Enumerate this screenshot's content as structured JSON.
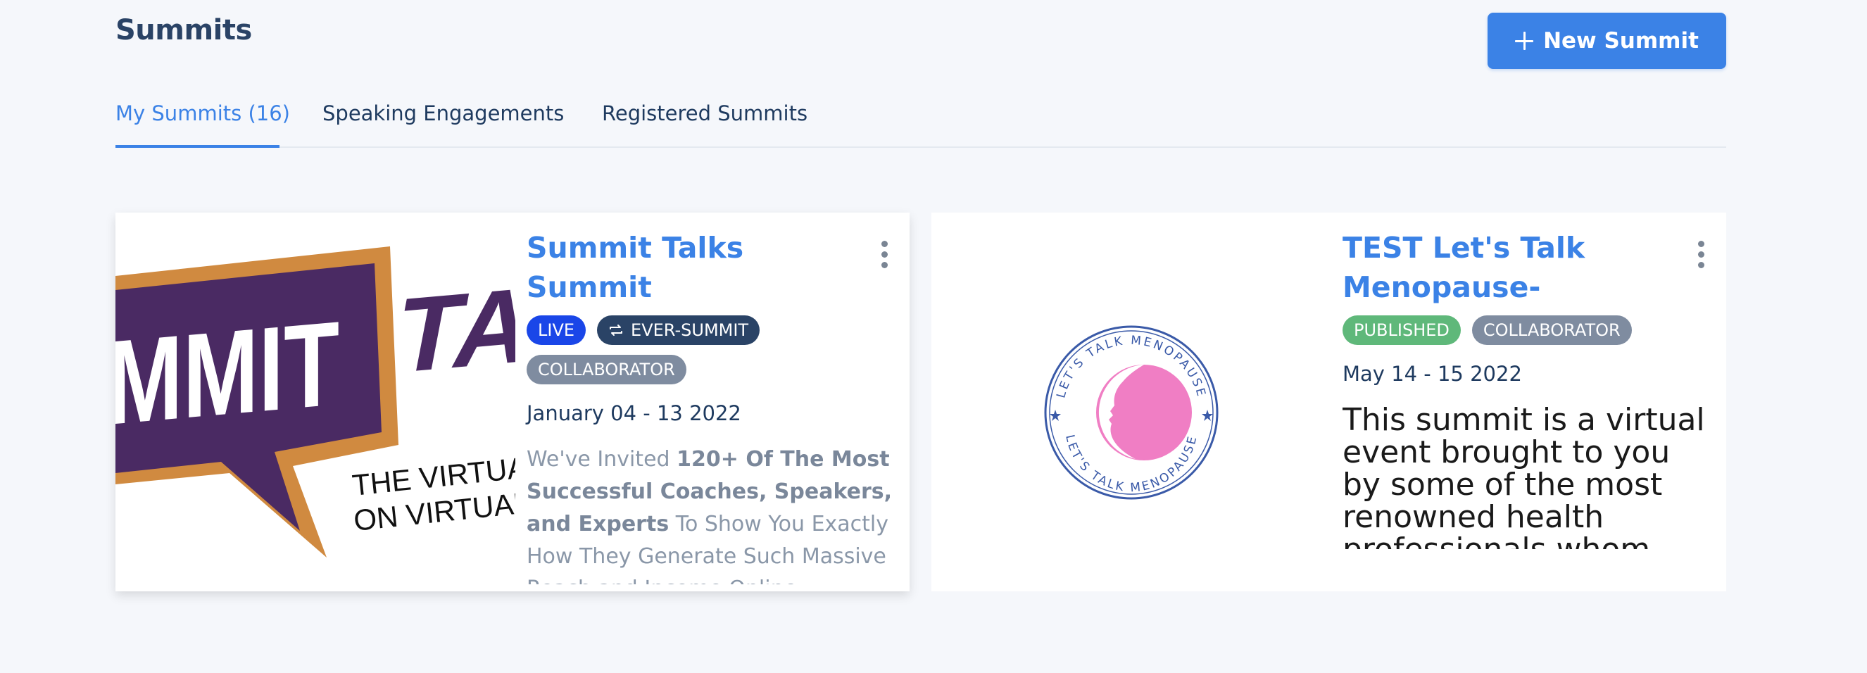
{
  "header": {
    "title": "Summits",
    "new_button_label": "New Summit"
  },
  "tabs": [
    {
      "label": "My Summits (16)",
      "active": true
    },
    {
      "label": "Speaking Engagements",
      "active": false
    },
    {
      "label": "Registered Summits",
      "active": false
    }
  ],
  "cards": [
    {
      "title": "Summit Talks Summit",
      "badges": [
        "LIVE",
        "EVER-SUMMIT",
        "COLLABORATOR"
      ],
      "date": "January 04 - 13 2022",
      "description_parts": [
        {
          "text": "We've Invited ",
          "bold": false
        },
        {
          "text": "120+ Of The Most Successful Coaches, Speakers, and Experts",
          "bold": true
        },
        {
          "text": " To Show You Exactly How They Generate Such Massive Reach and Income Online",
          "bold": false
        }
      ],
      "image": {
        "logo_text": "MMIT",
        "logo_text_2": "TA",
        "tagline_line1": "THE VIRTUA",
        "tagline_line2": "ON VIRTUAL"
      }
    },
    {
      "title": "TEST Let's Talk Menopause-",
      "badges": [
        "PUBLISHED",
        "COLLABORATOR"
      ],
      "date": "May 14 - 15 2022",
      "description": "This summit is a virtual event brought to you by some of the most renowned health professionals whom",
      "image": {
        "logo_text": "LET'S TALK MENOPAUSE"
      }
    }
  ],
  "colors": {
    "accent": "#3b82e6",
    "live": "#1a46e8",
    "ever_summit": "#2a4366",
    "collaborator": "#7f8ca0",
    "published": "#5fb87a"
  }
}
